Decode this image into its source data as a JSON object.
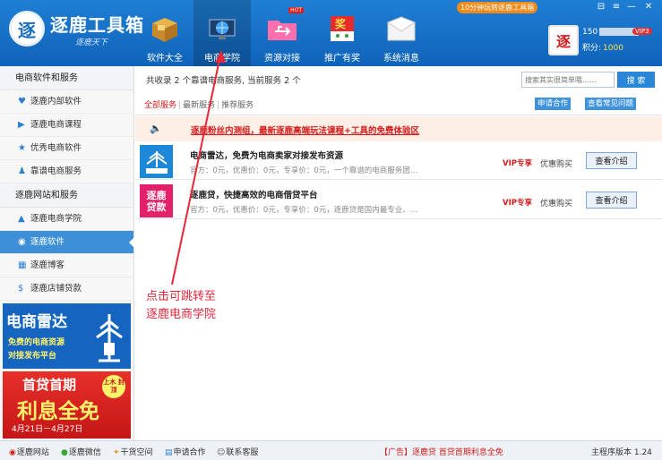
{
  "app": {
    "name": "逐鹿工具箱",
    "logo_glyph": "逐",
    "tagline": "逐鹿天下"
  },
  "promo_top": "10分钟玩转逐鹿工具箱",
  "window_controls": {
    "skin": "⊟",
    "menu": "≡",
    "minimize": "—",
    "close": "✕"
  },
  "nav": [
    {
      "label": "软件大全",
      "icon": "box-icon"
    },
    {
      "label": "电商学院",
      "icon": "globe-monitor-icon"
    },
    {
      "label": "资源对接",
      "icon": "usb-folder-icon",
      "badge": "HOT"
    },
    {
      "label": "推广有奖",
      "icon": "prize-box-icon",
      "badge_text": "奖"
    },
    {
      "label": "系统消息",
      "icon": "envelope-icon"
    }
  ],
  "user": {
    "avatar_glyph": "逐",
    "id_prefix": "150",
    "vip": "VIP3",
    "points_label": "积分:",
    "points": "1000"
  },
  "sidebar": {
    "group1": "电商软件和服务",
    "group1_items": [
      {
        "label": "逐鹿内部软件",
        "icon": "heart-icon"
      },
      {
        "label": "逐鹿电商课程",
        "icon": "play-icon"
      },
      {
        "label": "优秀电商软件",
        "icon": "star-icon"
      },
      {
        "label": "靠谱电商服务",
        "icon": "user-icon"
      }
    ],
    "group2": "逐鹿网站和服务",
    "group2_items": [
      {
        "label": "逐鹿电商学院",
        "icon": "graduation-cap-icon"
      },
      {
        "label": "逐鹿软件",
        "icon": "antenna-icon"
      },
      {
        "label": "逐鹿博客",
        "icon": "grid-icon"
      },
      {
        "label": "逐鹿店铺贷款",
        "icon": "money-bag-icon"
      }
    ]
  },
  "ads": {
    "radar_title": "电商雷达",
    "radar_line1": "免费的电商资源",
    "radar_line2": "对接发布平台",
    "loan_title1": "首贷首期",
    "loan_title2": "利息全免",
    "loan_badge": "上木 封顶",
    "loan_dates": "4月21日－4月27日"
  },
  "main": {
    "summary": "共收录 2 个靠谱电商服务, 当前服务 2 个",
    "search_placeholder": "搜索其实很简单哦……",
    "search_button": "搜 索",
    "filters": [
      "全部服务",
      "最新服务",
      "推荐服务"
    ],
    "apply_button": "申请合作",
    "faq_button": "查看常见问题",
    "notice": "逐鹿粉丝内测组，最新逐鹿高端玩法课程+工具的免费体验区",
    "services": [
      {
        "title": "电商雷达，免费为电商卖家对接发布资源",
        "desc": "官方：0元，优惠价：0元，专享价：0元，一个靠谱的电商服务团…",
        "vip": "VIP专享",
        "buy": "优惠购买",
        "detail": "查看介绍",
        "thumb_text": "电商雷达",
        "thumb_color": "#1e88d8"
      },
      {
        "title": "逐鹿贷，快捷高效的电商借贷平台",
        "desc": "官方：0元，优惠价：0元，专享价：0元，逐鹿贷是国内最专业、…",
        "vip": "VIP专享",
        "buy": "优惠购买",
        "detail": "查看介绍",
        "thumb_text": "逐鹿贷款",
        "thumb_color": "#e5206a"
      }
    ]
  },
  "annotation": {
    "line1": "点击可跳转至",
    "line2": "逐鹿电商学院"
  },
  "statusbar": {
    "links": [
      "逐鹿网站",
      "逐鹿微信",
      "干货空间",
      "申请合作",
      "联系客服"
    ],
    "ad": "【广告】逐鹿贷 首贷首期利息全免",
    "version": "主程序版本 1.24"
  },
  "colors": {
    "primary": "#1b6fc2",
    "accent_red": "#d31b1b",
    "notice_bg": "#fdeee6"
  }
}
